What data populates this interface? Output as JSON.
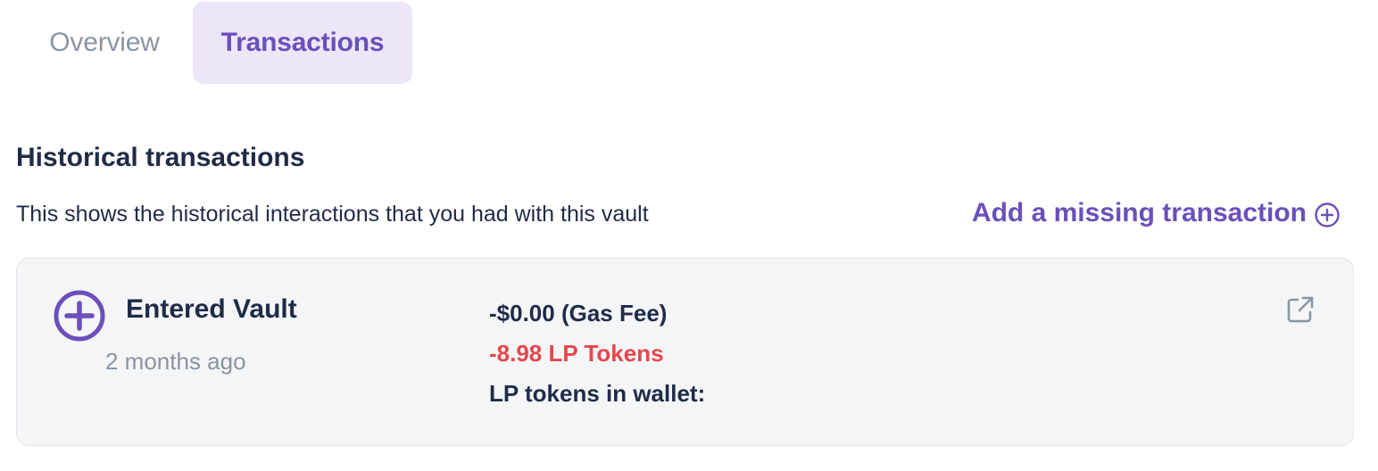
{
  "tabs": {
    "overview": "Overview",
    "transactions": "Transactions",
    "active": "transactions"
  },
  "section": {
    "title": "Historical transactions",
    "description": "This shows the historical interactions that you had with this vault",
    "add_missing_label": "Add a missing transaction",
    "add_missing_icon": "plus-circle-icon"
  },
  "transactions": [
    {
      "icon": "plus-circle-icon",
      "title": "Entered Vault",
      "time": "2 months ago",
      "gas_fee": "-$0.00 (Gas Fee)",
      "token_change": "-8.98 LP Tokens",
      "wallet_label": "LP tokens in wallet:",
      "link_icon": "external-link-icon"
    }
  ],
  "colors": {
    "accent": "#6b4fbb",
    "tab_active_bg": "#ece6f8",
    "negative": "#e5474d",
    "text_primary": "#1f2b48",
    "text_muted": "#8a94a3",
    "card_bg": "#f4f5f7"
  }
}
